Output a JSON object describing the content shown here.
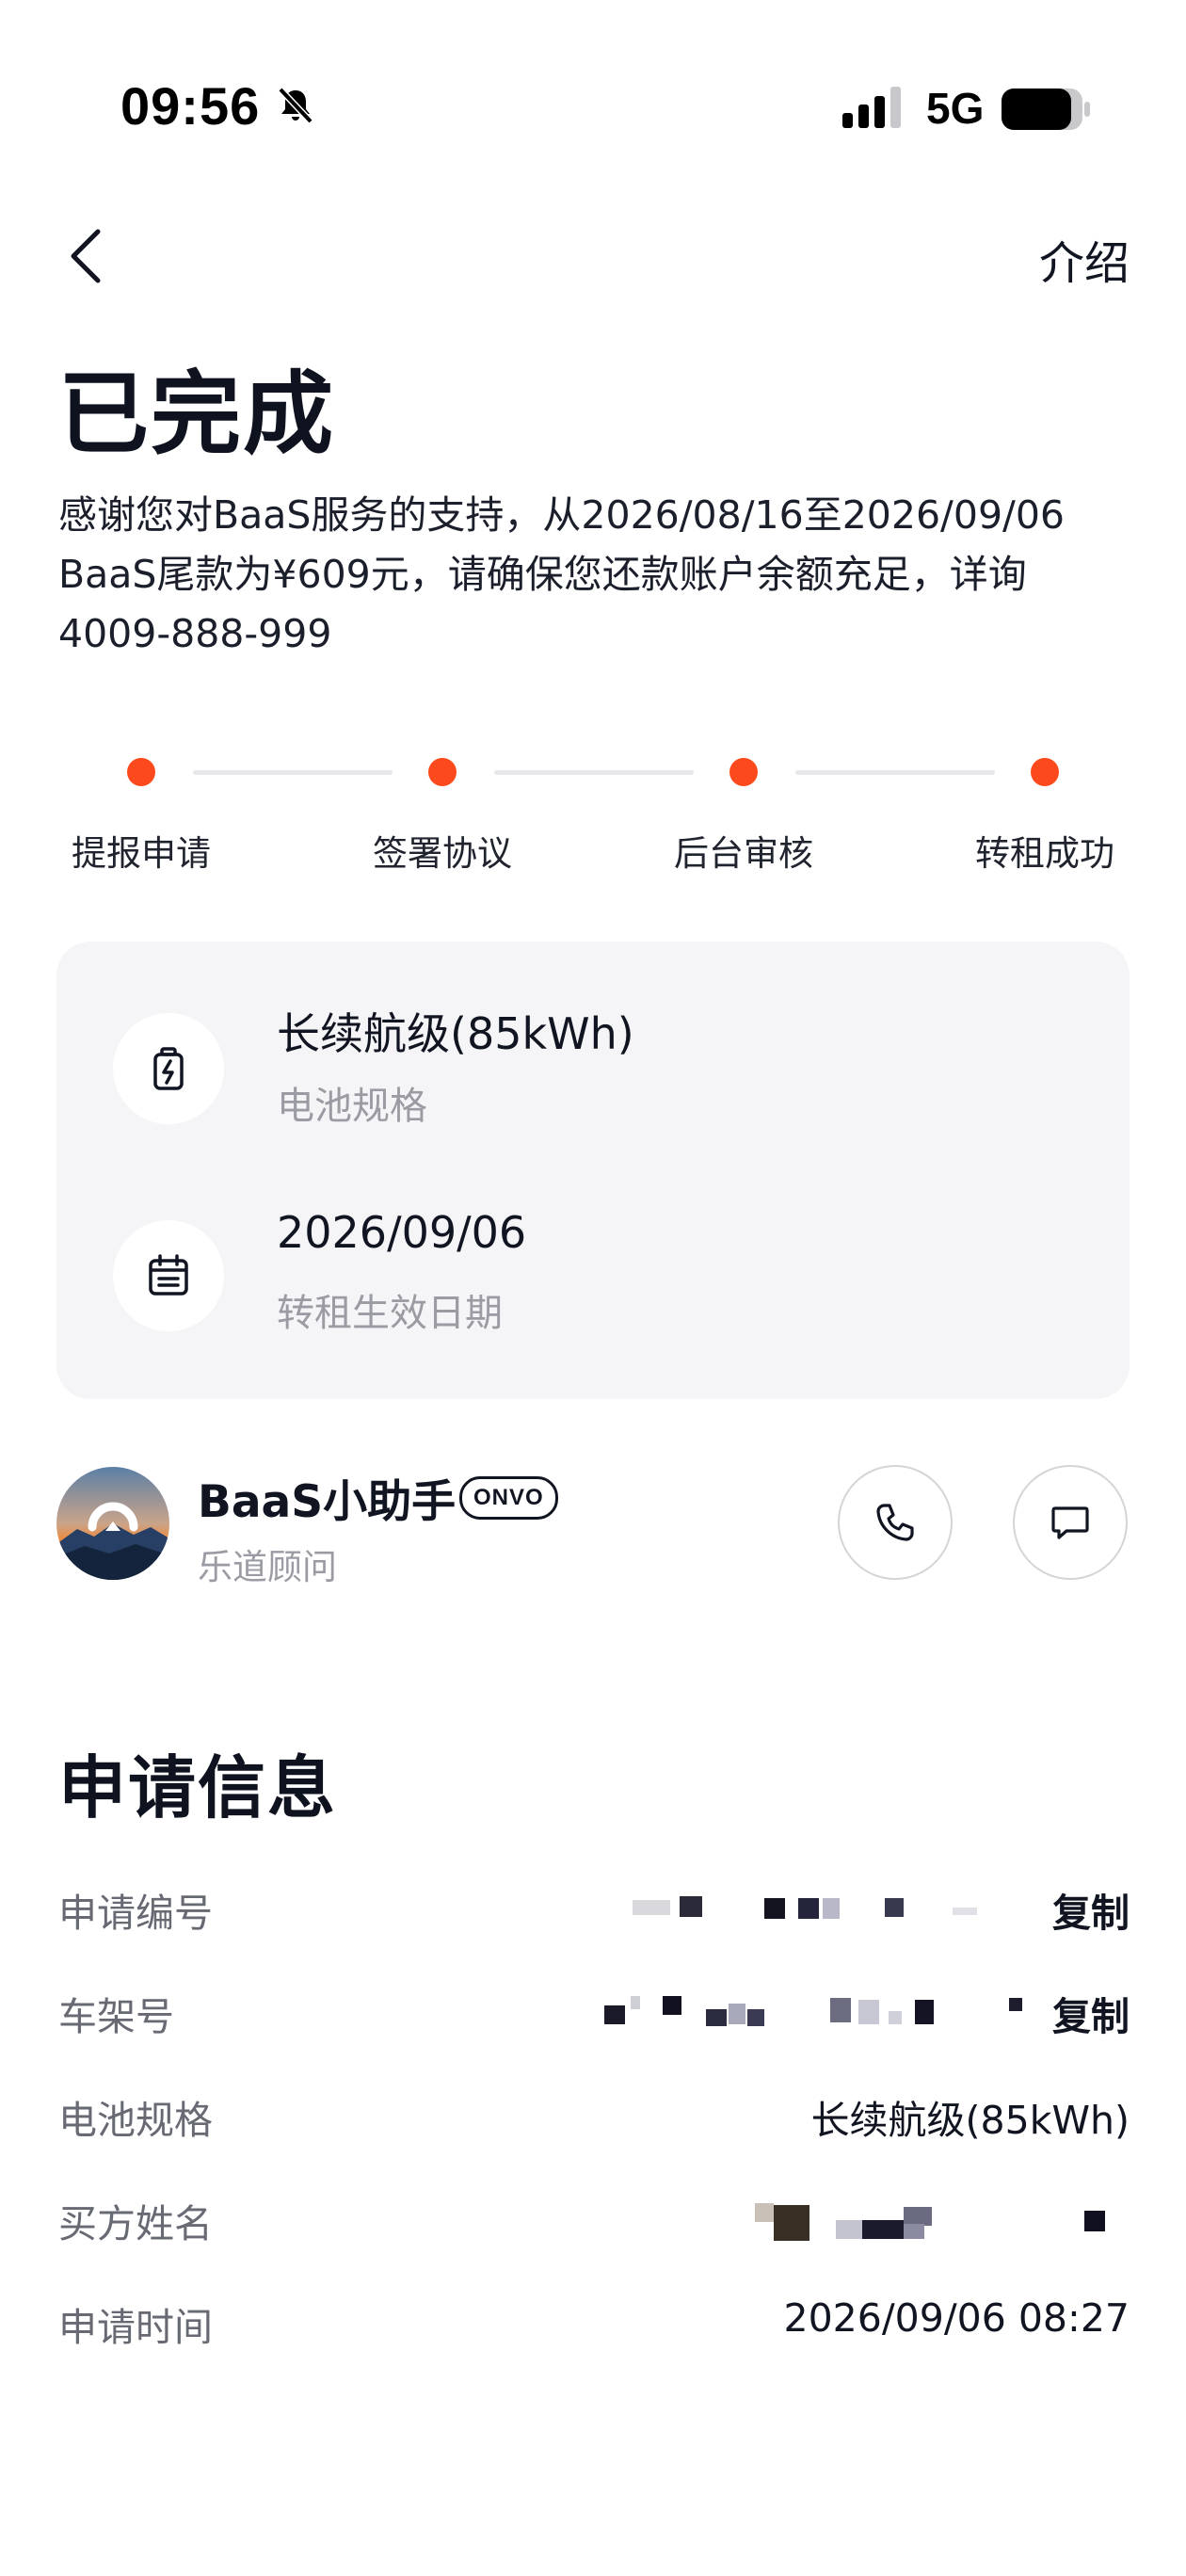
{
  "status_bar": {
    "time": "09:56",
    "network": "5G"
  },
  "nav": {
    "intro_label": "介绍"
  },
  "header": {
    "title": "已完成",
    "notice_line1": "感谢您对BaaS服务的支持，从2026/08/16至2026/09/06",
    "notice_line2": "BaaS尾款为¥609元，请确保您还款账户余额充足，详询",
    "notice_line3": "4009-888-999"
  },
  "steps": [
    {
      "label": "提报申请"
    },
    {
      "label": "签署协议"
    },
    {
      "label": "后台审核"
    },
    {
      "label": "转租成功"
    }
  ],
  "card": {
    "battery_value": "长续航级(85kWh)",
    "battery_label": "电池规格",
    "date_value": "2026/09/06",
    "date_label": "转租生效日期"
  },
  "assistant": {
    "name": "BaaS小助手",
    "badge": "ONVO",
    "role": "乐道顾问"
  },
  "application": {
    "section_title": "申请信息",
    "copy_label": "复制",
    "rows": [
      {
        "label": "申请编号",
        "value": ""
      },
      {
        "label": "车架号",
        "value": ""
      },
      {
        "label": "电池规格",
        "value": "长续航级(85kWh)"
      },
      {
        "label": "买方姓名",
        "value": ""
      },
      {
        "label": "申请时间",
        "value": "2026/09/06 08:27"
      }
    ]
  },
  "colors": {
    "accent": "#fd4a1d",
    "card_bg": "#f5f5f7",
    "muted_text": "#9b9ca3"
  }
}
